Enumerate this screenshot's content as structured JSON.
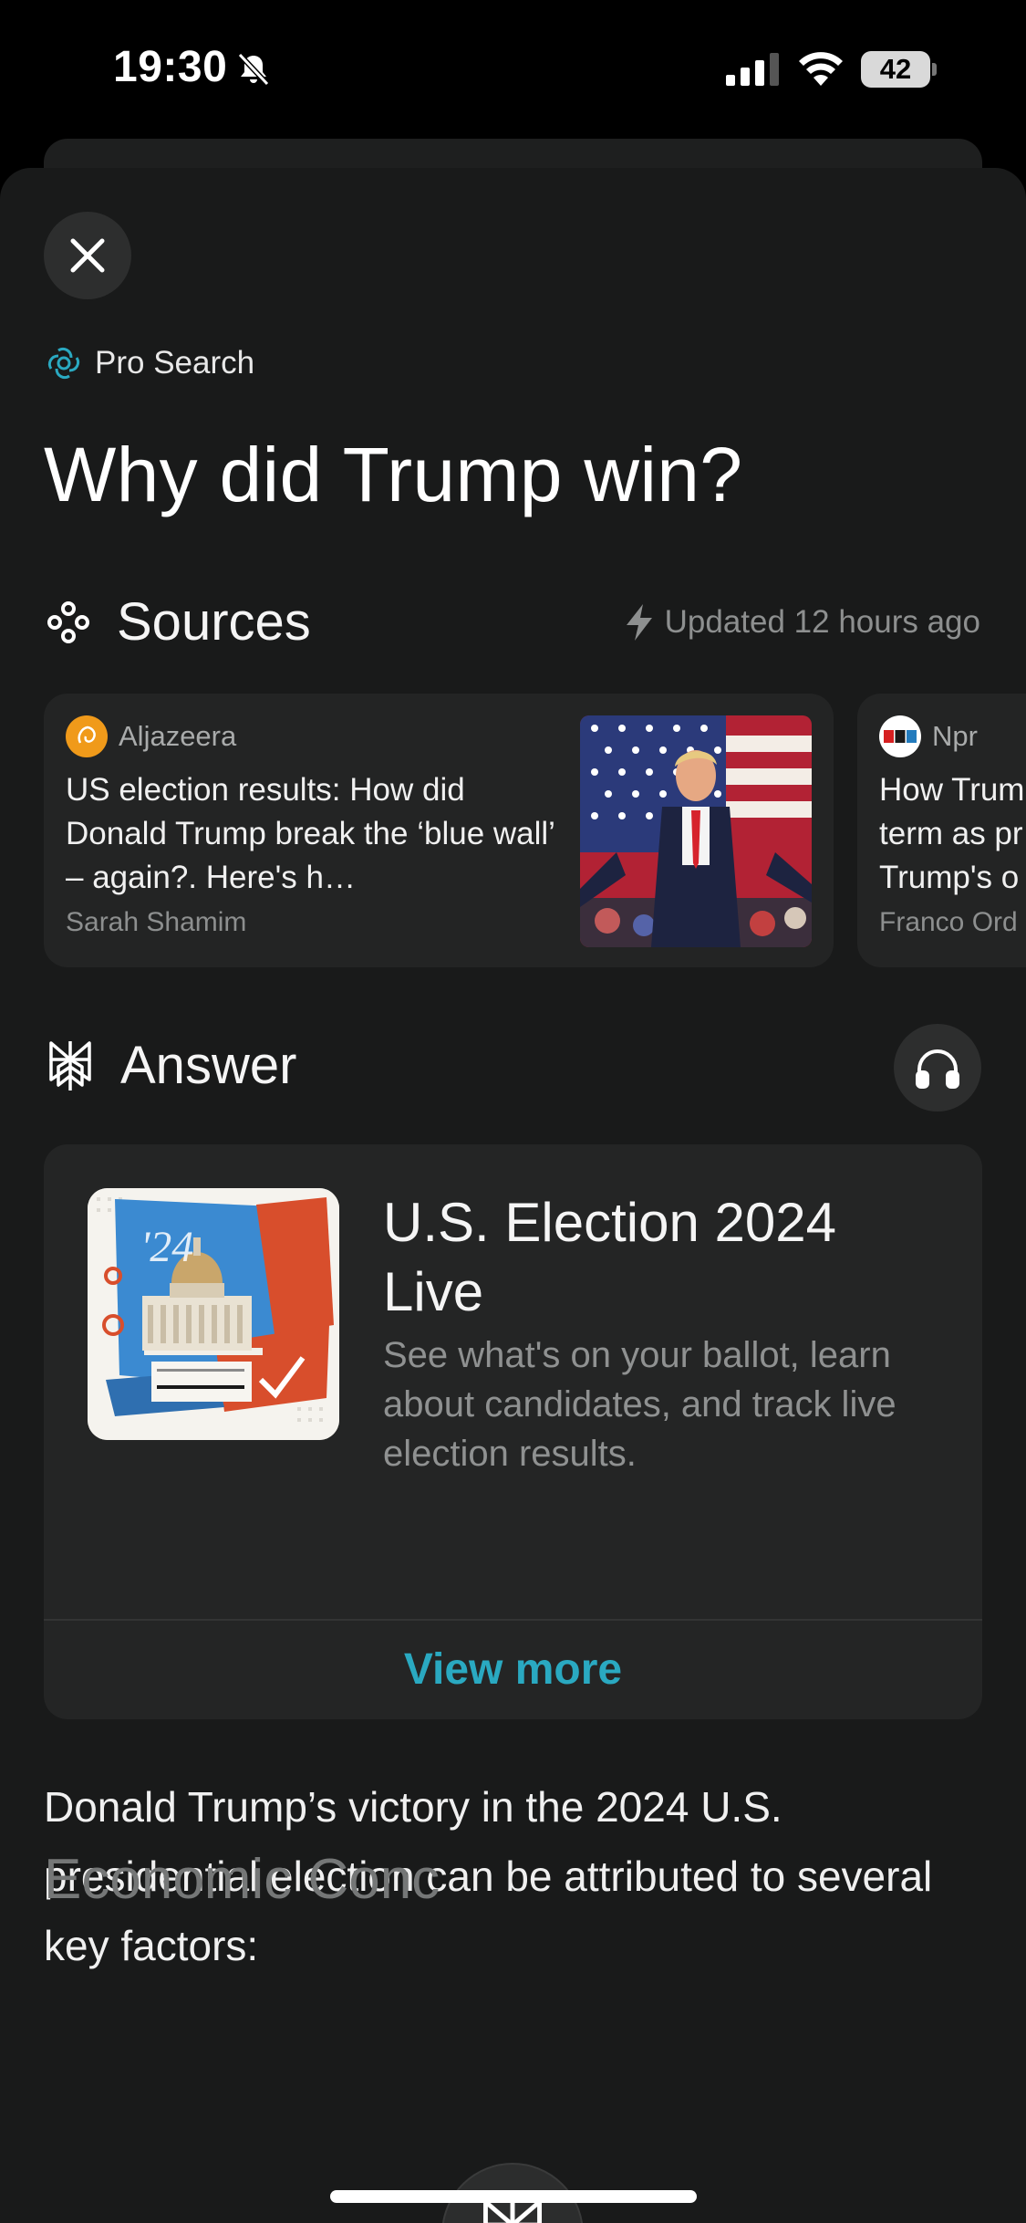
{
  "status_bar": {
    "time": "19:30",
    "battery": "42"
  },
  "header": {
    "mode_label": "Pro Search",
    "query": "Why did Trump win?"
  },
  "sources": {
    "title": "Sources",
    "updated": "Updated 12 hours ago",
    "cards": [
      {
        "source": "Aljazeera",
        "title": "US election results: How did Donald Trump break the ‘blue wall’ – again?. Here's h…",
        "author": "Sarah Shamim"
      },
      {
        "source": "Npr",
        "title": "How Trum term as pr Trump's o",
        "author": "Franco Ord"
      }
    ]
  },
  "answer": {
    "title": "Answer",
    "widget": {
      "title": "U.S. Election 2024 Live",
      "description": "See what's on your ballot, learn about candidates, and track live election results.",
      "link": "View more"
    },
    "body": "Donald Trump’s victory in the 2024 U.S. presidential election can be attributed to several key factors:",
    "subheading": "Economic Conc"
  },
  "colors": {
    "accent": "#2aa9c1",
    "background": "#191a1a",
    "card": "#232424"
  }
}
